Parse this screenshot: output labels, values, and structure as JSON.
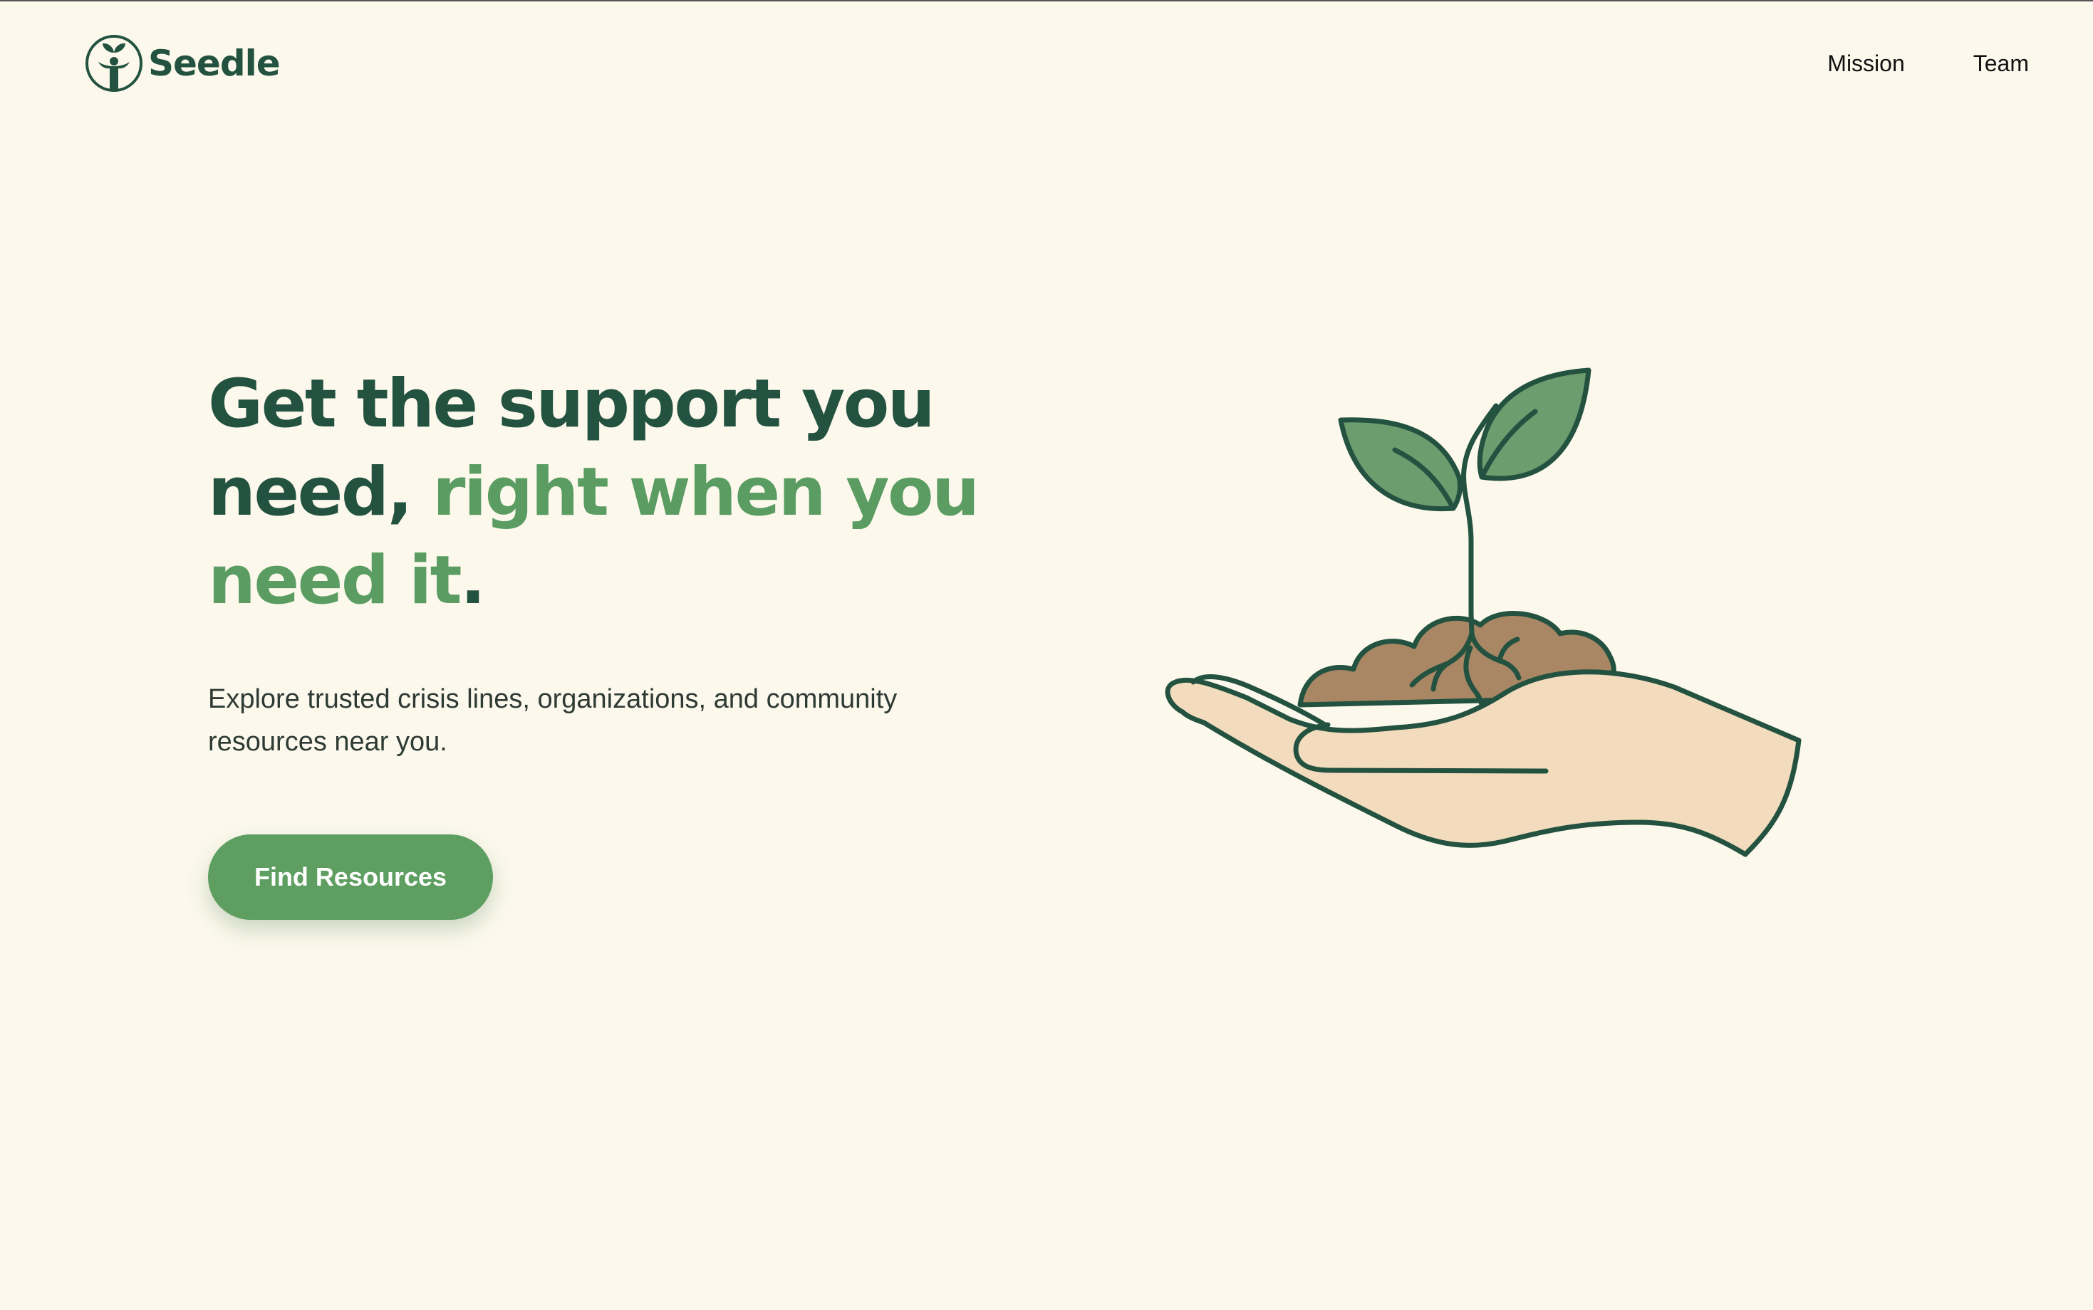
{
  "brand": {
    "name": "Seedle",
    "logo_icon": "person-sprout-icon"
  },
  "nav": {
    "items": [
      {
        "label": "Mission"
      },
      {
        "label": "Team"
      }
    ]
  },
  "hero": {
    "headline_part1": "Get the support you need, ",
    "headline_accent": "right when you need it",
    "headline_end": ".",
    "subtext": "Explore trusted crisis lines, organizations, and community resources near you.",
    "cta_label": "Find Resources",
    "illustration": "hand-holding-seedling-icon"
  },
  "colors": {
    "background": "#fcf9ec",
    "primary_dark": "#245240",
    "accent_green": "#5a9c62",
    "button": "#5e9e61",
    "soil": "#a98764",
    "skin": "#f3dcbd",
    "leaf": "#6c9d6f"
  }
}
